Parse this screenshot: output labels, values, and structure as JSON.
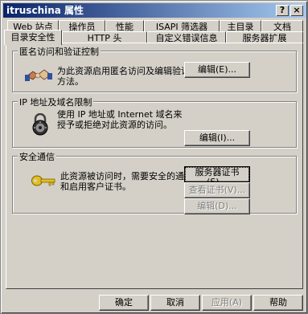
{
  "window": {
    "title": "itruschina 属性"
  },
  "title_buttons": {
    "help": "?",
    "close": "×"
  },
  "tabs_row1": [
    "Web 站点",
    "操作员",
    "性能",
    "ISAPI 筛选器",
    "主目录",
    "文档"
  ],
  "tabs_row2": [
    "目录安全性",
    "HTTP 头",
    "自定义错误信息",
    "服务器扩展"
  ],
  "active_tab": "目录安全性",
  "groups": {
    "anonymous": {
      "label": "匿名访问和验证控制",
      "description_line1": "为此资源启用匿名访问及编辑验证",
      "description_line2": "方法。",
      "button": "编辑(E)..."
    },
    "ip": {
      "label": "IP 地址及域名限制",
      "description_line1": "使用 IP 地址或 Internet 域名来",
      "description_line2": "授予或拒绝对此资源的访问。",
      "button": "编辑(I)..."
    },
    "secure": {
      "label": "安全通信",
      "description_line1": "此资源被访问时，需要安全的通信",
      "description_line2": "和启用客户证书。",
      "button_server_cert": "服务器证书(S)...",
      "button_view_cert": "查看证书(V)...",
      "button_edit": "编辑(D)..."
    }
  },
  "footer": {
    "ok": "确定",
    "cancel": "取消",
    "apply": "应用(A)",
    "help": "帮助"
  },
  "icons": {
    "handshake": "handshake-icon",
    "lock": "lock-icon",
    "key": "key-icon"
  },
  "colors": {
    "title_start": "#0a246a",
    "title_end": "#a6caf0",
    "face": "#d4d0c8"
  }
}
